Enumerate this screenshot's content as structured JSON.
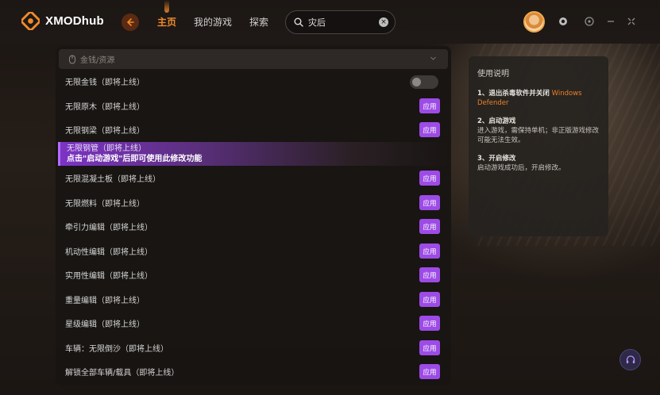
{
  "app": {
    "name": "XMODhub"
  },
  "nav": {
    "home": "主页",
    "my_games": "我的游戏",
    "explore": "探索"
  },
  "search": {
    "value": "灾后",
    "placeholder": ""
  },
  "section": {
    "title": "金钱/资源"
  },
  "apply_label": "应用",
  "rows": [
    {
      "label": "无限金钱（即将上线）"
    },
    {
      "label": "无限原木（即将上线）"
    },
    {
      "label": "无限钢梁（即将上线）"
    },
    {
      "label": "无限钢管（即将上线）",
      "tip": "点击\"启动游戏\"后即可使用此修改功能"
    },
    {
      "label": "无限混凝土板（即将上线）"
    },
    {
      "label": "无限燃料（即将上线）"
    },
    {
      "label": "牵引力编辑（即将上线）"
    },
    {
      "label": "机动性编辑（即将上线）"
    },
    {
      "label": "实用性编辑（即将上线）"
    },
    {
      "label": "重量编辑（即将上线）"
    },
    {
      "label": "星级编辑（即将上线）"
    },
    {
      "label": "车辆：无限倒沙（即将上线）"
    },
    {
      "label": "解锁全部车辆/载具（即将上线）"
    }
  ],
  "instructions": {
    "title": "使用说明",
    "step1_head": "1、退出杀毒软件并关闭",
    "step1_highlight": "Windows Defender",
    "step2_head": "2、启动游戏",
    "step2_body": "进入游戏，需保持单机；非正版游戏修改可能无法生效。",
    "step3_head": "3、开启修改",
    "step3_body": "启动游戏成功后，开启修改。"
  },
  "colors": {
    "accent_orange": "#f08a2c",
    "accent_purple": "#9d4be6"
  },
  "icons": [
    "logo-icon",
    "back-icon",
    "search-icon",
    "clear-icon",
    "settings-icon",
    "minimize-icon",
    "restore-icon",
    "mouse-icon",
    "chevron-down-icon",
    "headset-icon"
  ]
}
